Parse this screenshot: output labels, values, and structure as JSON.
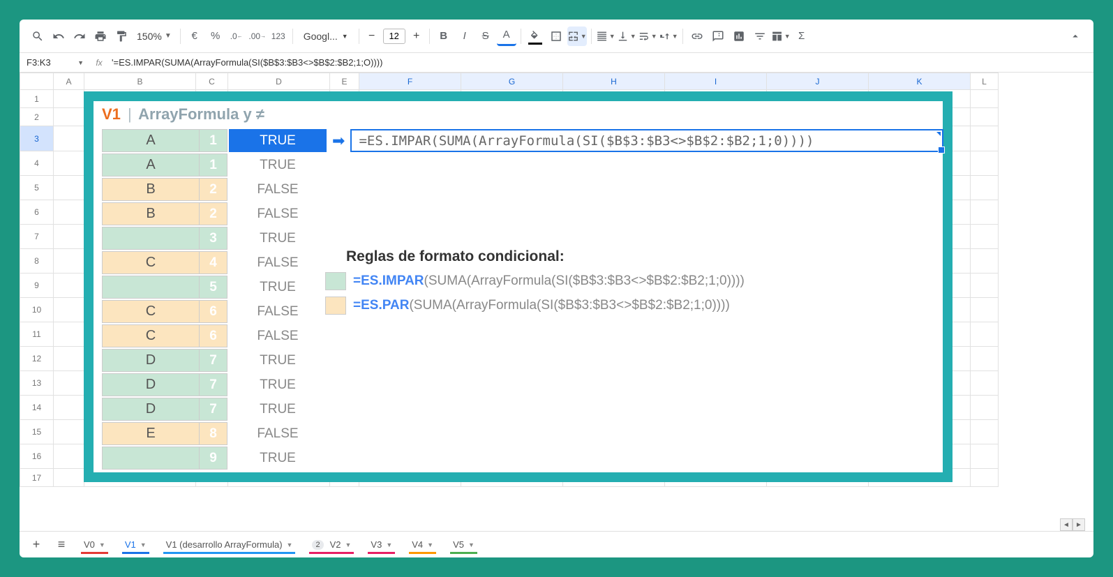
{
  "toolbar": {
    "zoom": "150%",
    "font": "Googl...",
    "font_size": "12"
  },
  "name_box": "F3:K3",
  "formula_bar": "'=ES.IMPAR(SUMA(ArrayFormula(SI($B$3:$B3<>$B$2:$B2;1;O))))",
  "columns": [
    "A",
    "B",
    "C",
    "D",
    "E",
    "F",
    "G",
    "H",
    "I",
    "J",
    "K",
    "L"
  ],
  "rows": [
    "1",
    "2",
    "3",
    "4",
    "5",
    "6",
    "7",
    "8",
    "9",
    "10",
    "11",
    "12",
    "13",
    "14",
    "15",
    "16",
    "17"
  ],
  "title": {
    "v": "V1",
    "pipe": "|",
    "rest": "ArrayFormula y ≠"
  },
  "data_rows": [
    {
      "b": "A",
      "c": "1",
      "d": "TRUE",
      "bg": "green",
      "sel": true
    },
    {
      "b": "A",
      "c": "1",
      "d": "TRUE",
      "bg": "green"
    },
    {
      "b": "B",
      "c": "2",
      "d": "FALSE",
      "bg": "orange"
    },
    {
      "b": "B",
      "c": "2",
      "d": "FALSE",
      "bg": "orange"
    },
    {
      "b": "",
      "c": "3",
      "d": "TRUE",
      "bg": "green"
    },
    {
      "b": "C",
      "c": "4",
      "d": "FALSE",
      "bg": "orange"
    },
    {
      "b": "",
      "c": "5",
      "d": "TRUE",
      "bg": "green"
    },
    {
      "b": "C",
      "c": "6",
      "d": "FALSE",
      "bg": "orange"
    },
    {
      "b": "C",
      "c": "6",
      "d": "FALSE",
      "bg": "orange"
    },
    {
      "b": "D",
      "c": "7",
      "d": "TRUE",
      "bg": "green"
    },
    {
      "b": "D",
      "c": "7",
      "d": "TRUE",
      "bg": "green"
    },
    {
      "b": "D",
      "c": "7",
      "d": "TRUE",
      "bg": "green"
    },
    {
      "b": "E",
      "c": "8",
      "d": "FALSE",
      "bg": "orange"
    },
    {
      "b": "",
      "c": "9",
      "d": "TRUE",
      "bg": "green"
    }
  ],
  "main_formula": "=ES.IMPAR(SUMA(ArrayFormula(SI($B$3:$B3<>$B$2:$B2;1;0))))",
  "rules_title": "Reglas de formato condicional:",
  "rule1_fn": "=ES.IMPAR",
  "rule1_rest": "(SUMA(ArrayFormula(SI($B$3:$B3<>$B$2:$B2;1;0))))",
  "rule2_fn": "=ES.PAR",
  "rule2_rest": "(SUMA(ArrayFormula(SI($B$3:$B3<>$B$2:$B2;1;0))))",
  "tabs": [
    {
      "label": "V0",
      "ul": "ul-red"
    },
    {
      "label": "V1",
      "ul": "ul-blue",
      "active": true
    },
    {
      "label": "V1 (desarrollo ArrayFormula)",
      "ul": "ul-blueg"
    },
    {
      "label": "V2",
      "ul": "ul-pink",
      "badge": "2"
    },
    {
      "label": "V3",
      "ul": "ul-pink"
    },
    {
      "label": "V4",
      "ul": "ul-orange"
    },
    {
      "label": "V5",
      "ul": "ul-green"
    }
  ]
}
